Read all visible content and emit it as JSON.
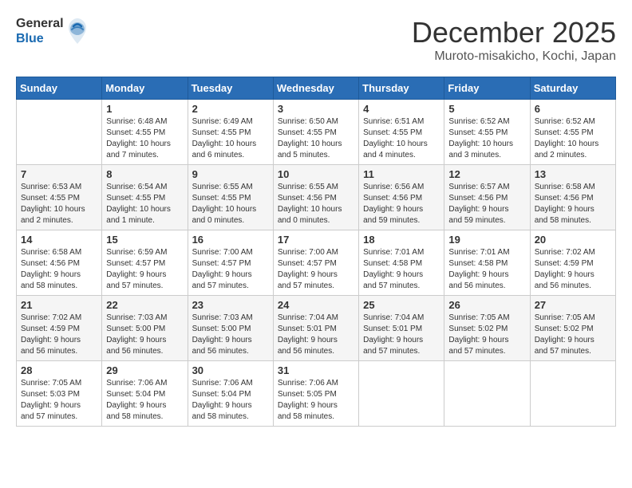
{
  "header": {
    "logo_line1": "General",
    "logo_line2": "Blue",
    "title": "December 2025",
    "subtitle": "Muroto-misakicho, Kochi, Japan"
  },
  "weekdays": [
    "Sunday",
    "Monday",
    "Tuesday",
    "Wednesday",
    "Thursday",
    "Friday",
    "Saturday"
  ],
  "weeks": [
    [
      {
        "day": "",
        "info": ""
      },
      {
        "day": "1",
        "info": "Sunrise: 6:48 AM\nSunset: 4:55 PM\nDaylight: 10 hours\nand 7 minutes."
      },
      {
        "day": "2",
        "info": "Sunrise: 6:49 AM\nSunset: 4:55 PM\nDaylight: 10 hours\nand 6 minutes."
      },
      {
        "day": "3",
        "info": "Sunrise: 6:50 AM\nSunset: 4:55 PM\nDaylight: 10 hours\nand 5 minutes."
      },
      {
        "day": "4",
        "info": "Sunrise: 6:51 AM\nSunset: 4:55 PM\nDaylight: 10 hours\nand 4 minutes."
      },
      {
        "day": "5",
        "info": "Sunrise: 6:52 AM\nSunset: 4:55 PM\nDaylight: 10 hours\nand 3 minutes."
      },
      {
        "day": "6",
        "info": "Sunrise: 6:52 AM\nSunset: 4:55 PM\nDaylight: 10 hours\nand 2 minutes."
      }
    ],
    [
      {
        "day": "7",
        "info": "Sunrise: 6:53 AM\nSunset: 4:55 PM\nDaylight: 10 hours\nand 2 minutes."
      },
      {
        "day": "8",
        "info": "Sunrise: 6:54 AM\nSunset: 4:55 PM\nDaylight: 10 hours\nand 1 minute."
      },
      {
        "day": "9",
        "info": "Sunrise: 6:55 AM\nSunset: 4:55 PM\nDaylight: 10 hours\nand 0 minutes."
      },
      {
        "day": "10",
        "info": "Sunrise: 6:55 AM\nSunset: 4:56 PM\nDaylight: 10 hours\nand 0 minutes."
      },
      {
        "day": "11",
        "info": "Sunrise: 6:56 AM\nSunset: 4:56 PM\nDaylight: 9 hours\nand 59 minutes."
      },
      {
        "day": "12",
        "info": "Sunrise: 6:57 AM\nSunset: 4:56 PM\nDaylight: 9 hours\nand 59 minutes."
      },
      {
        "day": "13",
        "info": "Sunrise: 6:58 AM\nSunset: 4:56 PM\nDaylight: 9 hours\nand 58 minutes."
      }
    ],
    [
      {
        "day": "14",
        "info": "Sunrise: 6:58 AM\nSunset: 4:56 PM\nDaylight: 9 hours\nand 58 minutes."
      },
      {
        "day": "15",
        "info": "Sunrise: 6:59 AM\nSunset: 4:57 PM\nDaylight: 9 hours\nand 57 minutes."
      },
      {
        "day": "16",
        "info": "Sunrise: 7:00 AM\nSunset: 4:57 PM\nDaylight: 9 hours\nand 57 minutes."
      },
      {
        "day": "17",
        "info": "Sunrise: 7:00 AM\nSunset: 4:57 PM\nDaylight: 9 hours\nand 57 minutes."
      },
      {
        "day": "18",
        "info": "Sunrise: 7:01 AM\nSunset: 4:58 PM\nDaylight: 9 hours\nand 57 minutes."
      },
      {
        "day": "19",
        "info": "Sunrise: 7:01 AM\nSunset: 4:58 PM\nDaylight: 9 hours\nand 56 minutes."
      },
      {
        "day": "20",
        "info": "Sunrise: 7:02 AM\nSunset: 4:59 PM\nDaylight: 9 hours\nand 56 minutes."
      }
    ],
    [
      {
        "day": "21",
        "info": "Sunrise: 7:02 AM\nSunset: 4:59 PM\nDaylight: 9 hours\nand 56 minutes."
      },
      {
        "day": "22",
        "info": "Sunrise: 7:03 AM\nSunset: 5:00 PM\nDaylight: 9 hours\nand 56 minutes."
      },
      {
        "day": "23",
        "info": "Sunrise: 7:03 AM\nSunset: 5:00 PM\nDaylight: 9 hours\nand 56 minutes."
      },
      {
        "day": "24",
        "info": "Sunrise: 7:04 AM\nSunset: 5:01 PM\nDaylight: 9 hours\nand 56 minutes."
      },
      {
        "day": "25",
        "info": "Sunrise: 7:04 AM\nSunset: 5:01 PM\nDaylight: 9 hours\nand 57 minutes."
      },
      {
        "day": "26",
        "info": "Sunrise: 7:05 AM\nSunset: 5:02 PM\nDaylight: 9 hours\nand 57 minutes."
      },
      {
        "day": "27",
        "info": "Sunrise: 7:05 AM\nSunset: 5:02 PM\nDaylight: 9 hours\nand 57 minutes."
      }
    ],
    [
      {
        "day": "28",
        "info": "Sunrise: 7:05 AM\nSunset: 5:03 PM\nDaylight: 9 hours\nand 57 minutes."
      },
      {
        "day": "29",
        "info": "Sunrise: 7:06 AM\nSunset: 5:04 PM\nDaylight: 9 hours\nand 58 minutes."
      },
      {
        "day": "30",
        "info": "Sunrise: 7:06 AM\nSunset: 5:04 PM\nDaylight: 9 hours\nand 58 minutes."
      },
      {
        "day": "31",
        "info": "Sunrise: 7:06 AM\nSunset: 5:05 PM\nDaylight: 9 hours\nand 58 minutes."
      },
      {
        "day": "",
        "info": ""
      },
      {
        "day": "",
        "info": ""
      },
      {
        "day": "",
        "info": ""
      }
    ]
  ]
}
